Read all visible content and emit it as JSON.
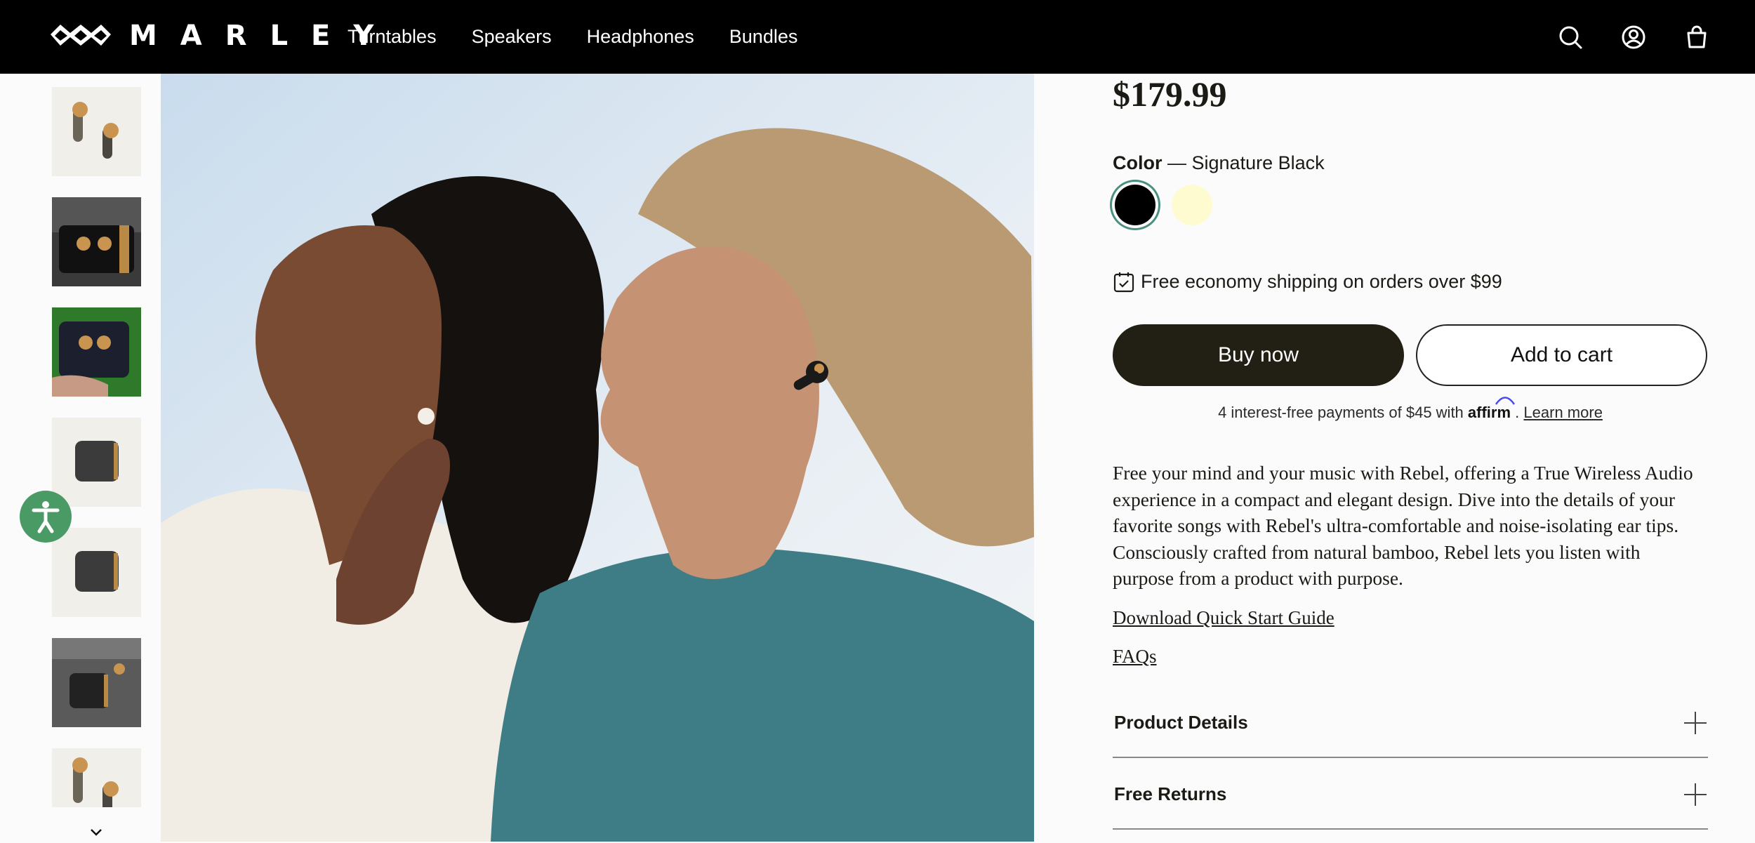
{
  "header": {
    "logo_text": "MARLEY",
    "nav": [
      "Turntables",
      "Speakers",
      "Headphones",
      "Bundles"
    ],
    "icons": [
      "search-icon",
      "account-icon",
      "cart-icon"
    ]
  },
  "gallery": {
    "thumbnails": [
      "earbuds-pair",
      "earbuds-open-case",
      "earbuds-case-in-hand",
      "closed-case",
      "closed-case",
      "case-on-console",
      "earbuds-pair"
    ],
    "scroll_icon": "chevron-down-icon"
  },
  "product": {
    "price": "$179.99",
    "color_label": "Color",
    "color_separator": " — ",
    "color_value": "Signature Black",
    "swatches": [
      {
        "name": "Signature Black",
        "hex": "#000000"
      },
      {
        "name": "Cream",
        "hex": "#fffbd0"
      }
    ],
    "shipping": "Free economy shipping on orders over $99",
    "buy_now": "Buy now",
    "add_to_cart": "Add to cart",
    "affirm_prefix": "4 interest-free payments of $45 with",
    "affirm_brand": "affirm",
    "affirm_period": ".",
    "affirm_link": "Learn more",
    "description": "Free your mind and your music with Rebel, offering a True Wireless Audio experience in a compact and elegant design. Dive into the details of your favorite songs with Rebel's ultra-comfortable and noise-isolating ear tips. Consciously crafted from natural bamboo, Rebel lets you listen with purpose from a product with purpose.",
    "guide_link": "Download Quick Start Guide",
    "faq_link": "FAQs",
    "accordions": [
      "Product Details",
      "Free Returns"
    ]
  },
  "colors": {
    "header_bg": "#000000",
    "primary_button": "#221f15",
    "swatch_ring": "#4a8f80",
    "a11y_button": "#4a9a66"
  }
}
